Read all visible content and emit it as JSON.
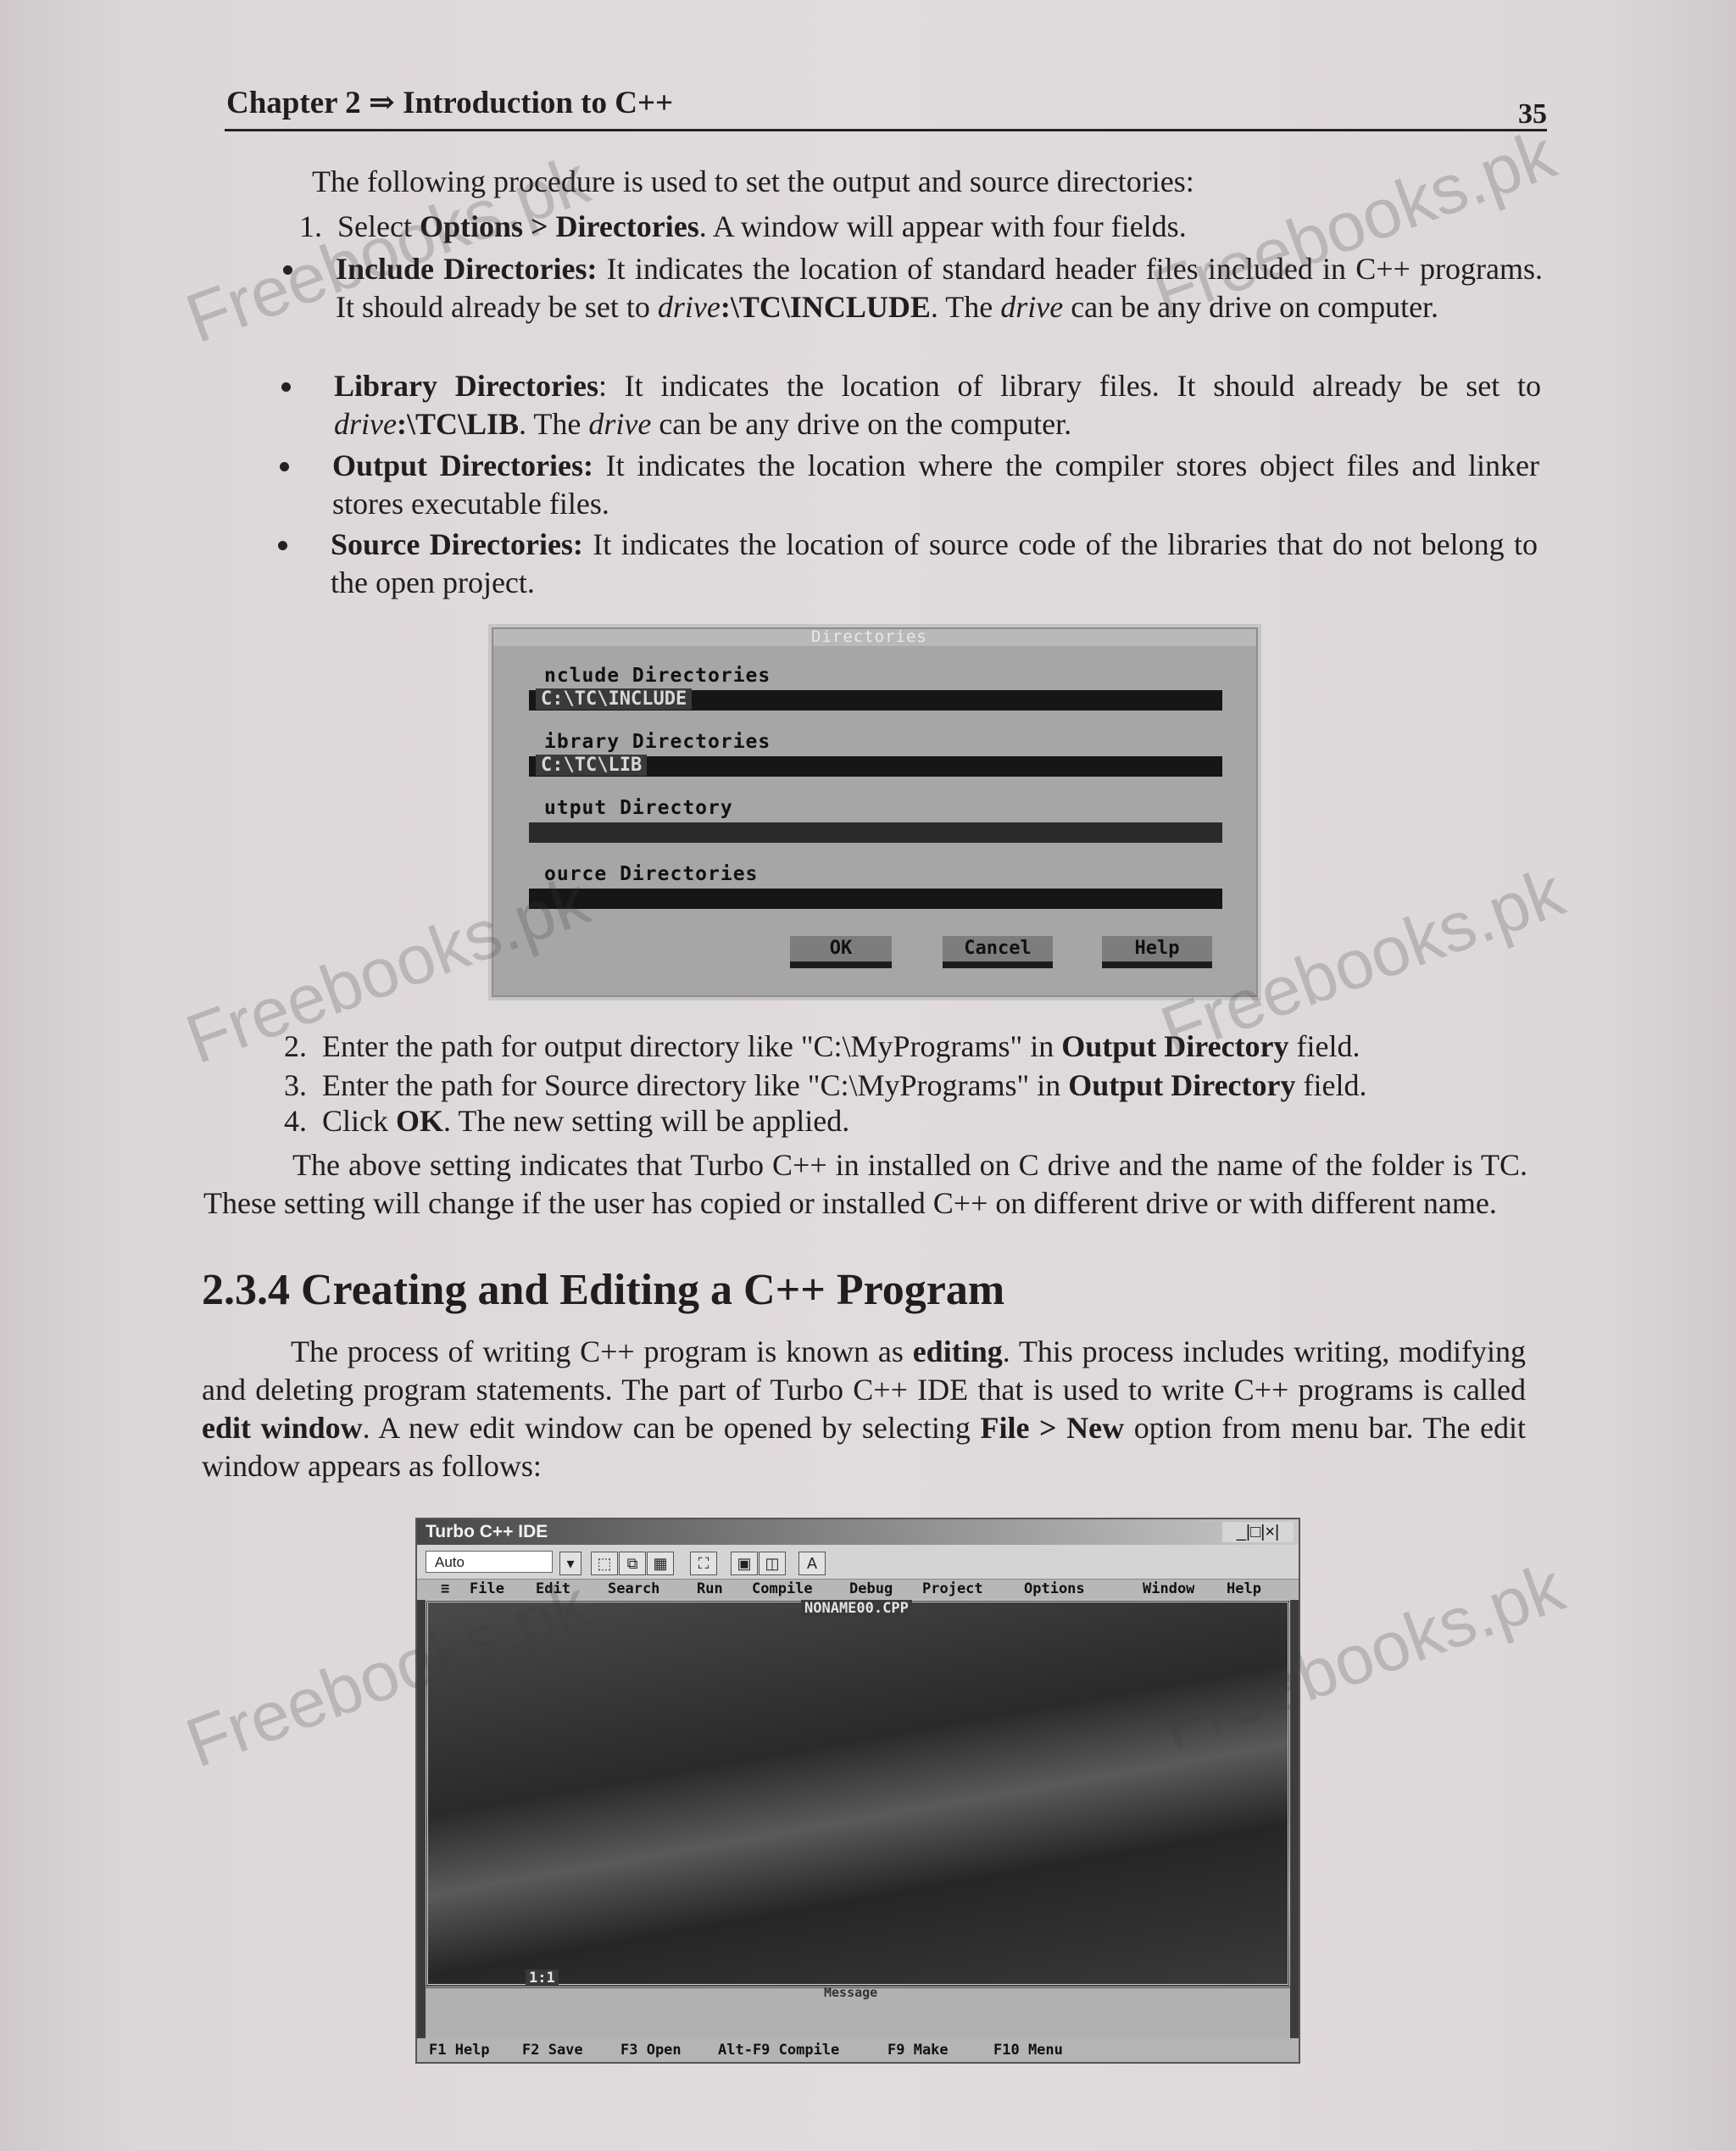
{
  "header": {
    "chapter_title": "Chapter 2 ⇒ Introduction to C++",
    "page_number": "35"
  },
  "intro": "The following procedure is used to set the output and source directories:",
  "steps": [
    {
      "num": "1.",
      "prefix": "Select ",
      "bold": "Options > Directories",
      "suffix": ". A window will appear with four fields."
    },
    {
      "num": "2.",
      "prefix": "Enter the path for output directory like \"C:\\MyPrograms\" in ",
      "bold": "Output Directory",
      "suffix": " field."
    },
    {
      "num": "3.",
      "prefix": "Enter the path for Source directory like \"C:\\MyPrograms\" in ",
      "bold": "Output Directory",
      "suffix": " field."
    },
    {
      "num": "4.",
      "prefix": "Click ",
      "bold": "OK",
      "suffix": ". The new setting will be applied."
    }
  ],
  "bullets": [
    {
      "term": "Include Directories:",
      "text1": " It indicates the location of standard header files included in C++ programs. It should already be set to ",
      "em": "drive",
      "text2": ":\\TC\\INCLUDE",
      "text3": ". The ",
      "em2": "drive",
      "text4": " can be any drive on computer."
    },
    {
      "term": "Library Directories",
      "text1": ": It indicates the location of library files. It should already be set to ",
      "em": "drive",
      "text2": ":\\TC\\LIB",
      "text3": ". The ",
      "em2": "drive",
      "text4": " can be any drive on the computer."
    },
    {
      "term": "Output Directories:",
      "text1": " It indicates the location where the compiler stores object files and linker stores executable files."
    },
    {
      "term": "Source Directories:",
      "text1": " It indicates the location of source code of the libraries that do not belong to the open project."
    }
  ],
  "directories_dialog": {
    "title": "Directories",
    "fields": [
      {
        "label": "nclude Directories",
        "value": "C:\\TC\\INCLUDE"
      },
      {
        "label": "ibrary Directories",
        "value": "C:\\TC\\LIB"
      },
      {
        "label": "utput Directory",
        "value": ""
      },
      {
        "label": "ource Directories",
        "value": ""
      }
    ],
    "buttons": {
      "ok": "OK",
      "cancel": "Cancel",
      "help": "Help"
    }
  },
  "para_setting": "The above setting indicates that Turbo C++ in installed on C drive and the name of the folder is TC. These setting will change if the user has copied or installed C++ on different drive or with different name.",
  "section_title": "2.3.4 Creating and Editing a C++ Program",
  "para_edit": {
    "t1": "The process of writing C++ program is known as ",
    "b1": "editing",
    "t2": ". This process includes writing, modifying and deleting program statements. The part of Turbo C++ IDE that is used to write C++ programs is called ",
    "b2": "edit window",
    "t3": ". A new edit window can be opened by selecting ",
    "b3": "File > New",
    "t4": " option from menu bar. The edit window appears as follows:"
  },
  "ide": {
    "window_title": "Turbo C++ IDE",
    "window_controls": "_|□|×|",
    "font_select": "Auto",
    "toolbar_letter": "A",
    "menu": [
      "≡",
      "File",
      "Edit",
      "Search",
      "Run",
      "Compile",
      "Debug",
      "Project",
      "Options",
      "Window",
      "Help"
    ],
    "file_name": "NONAME00.CPP",
    "cursor_pos": "1:1",
    "message_title": "Message",
    "status": [
      "F1 Help",
      "F2 Save",
      "F3 Open",
      "Alt-F9 Compile",
      "F9 Make",
      "F10 Menu"
    ]
  },
  "watermark": "Freebooks.pk"
}
